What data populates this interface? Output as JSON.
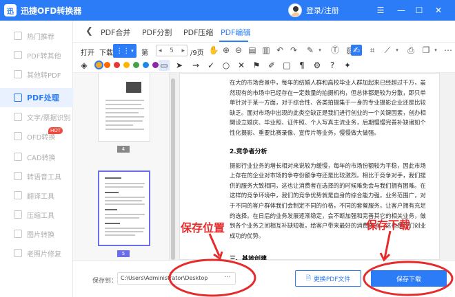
{
  "app": {
    "title": "迅捷OFD转换器",
    "login": "登录/注册"
  },
  "sidebar": {
    "items": [
      {
        "label": "热门推荐",
        "icon": "fire-icon"
      },
      {
        "label": "PDF转其他",
        "icon": "pdf-export-icon"
      },
      {
        "label": "其他转PDF",
        "icon": "pdf-import-icon"
      },
      {
        "label": "PDF处理",
        "icon": "pdf-process-icon",
        "active": true
      },
      {
        "label": "文字/票据识别",
        "icon": "ocr-icon"
      },
      {
        "label": "OFD转换",
        "icon": "ofd-icon",
        "badge": "HOT"
      },
      {
        "label": "CAD转换",
        "icon": "cad-icon"
      },
      {
        "label": "转语音工具",
        "icon": "voice-icon"
      },
      {
        "label": "翻译工具",
        "icon": "translate-icon"
      },
      {
        "label": "压缩工具",
        "icon": "compress-icon"
      },
      {
        "label": "图片转换",
        "icon": "image-icon"
      },
      {
        "label": "老照片修复",
        "icon": "photo-icon"
      }
    ]
  },
  "tabs": {
    "items": [
      "PDF合并",
      "PDF分割",
      "PDF压缩",
      "PDF编辑"
    ],
    "active": "PDF编辑"
  },
  "toolbar": {
    "open": "打开",
    "download": "下载",
    "page_prefix": "第",
    "page_current": "5",
    "page_total": "/9页"
  },
  "colors": {
    "accent": "#2b7cf6",
    "palette": [
      "#f5a623",
      "#ff6a00",
      "#e53935",
      "#ffb300",
      "#43a047",
      "#1e88e5",
      "#8e24aa"
    ]
  },
  "thumbnails": [
    {
      "page": "4"
    },
    {
      "page": "5",
      "selected": true
    }
  ],
  "document": {
    "para1": "在大的市场背景中，每年的结婚人群和高校毕业人群加起来已经超过千万，虽然现有的市场中已经存在一定数量的拍摄机构，但总体都是较为分散，即只单单针对于某一方面，对于综合性、各类拍摄集于一身的专业摄影企业还是比较缺乏。面对市场中出现的此类空缺正是我们进行创业的一个关键因素，创办相関设立婚庆、毕业照、证件照、个人写真主流业务，后期慢慢完善补缺诸如个性化摄影、重要比赛录像、宣传片等业务，慢慢做大做强。",
    "heading2": "2.竞争者分析",
    "para2": "摄影行业业务的增长相对来说较为缓慢，每年的市场份额较为平稳，因此市场上存在的企业对市场的争夺份额争夺还是比较激烈。相比于竞争对手，我们提供的服务大致相同，这也让消费者在选择的的时候难免会与我们拥有困难。在这样的竞争环境中，我们的竞争优势就是自身的综合能力强，业务范围广，对于不同的客户群体我们会制定不同的价格，不同的套餐服务，让客户拥有充足的选择。在日后的业务发展逐渐稳定，会不断加强和完善其它的相关业务，做到各个业务之间相互补缺短板，给客户带来最好的消费体验。这也是我们创业成功的优势。",
    "heading3": "三、基地创建"
  },
  "bottom": {
    "save_to_label": "保存到：",
    "path": "C:\\Users\\Administrator\\Desktop",
    "path_dots": "···",
    "change_button": "更换PDF文件",
    "save_button": "保存下载"
  },
  "annotations": {
    "save_location": "保存位置",
    "save_download": "保存下载",
    "color": "#e52b2b"
  }
}
